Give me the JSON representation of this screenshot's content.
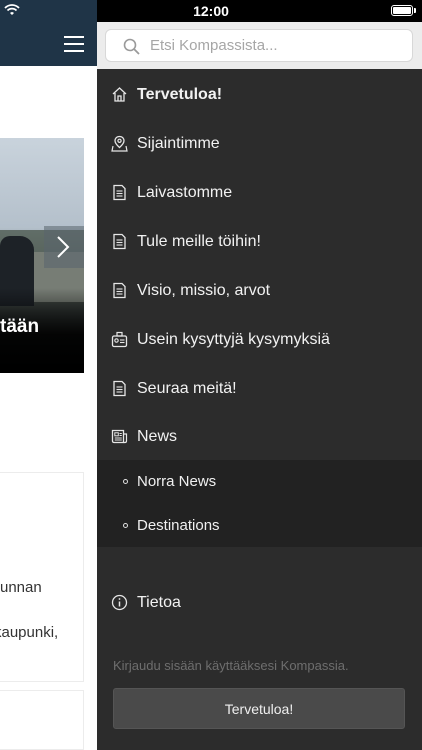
{
  "status_bar": {
    "time": "12:00"
  },
  "background_app": {
    "hero_title": "tään",
    "card": {
      "line1": "unnan",
      "line2": "kaupunki,"
    }
  },
  "drawer": {
    "search": {
      "placeholder": "Etsi Kompassista..."
    },
    "menu": [
      {
        "label": "Tervetuloa!",
        "icon": "home-icon"
      },
      {
        "label": "Sijaintimme",
        "icon": "map-pin-icon"
      },
      {
        "label": "Laivastomme",
        "icon": "document-icon"
      },
      {
        "label": "Tule meille töihin!",
        "icon": "document-icon"
      },
      {
        "label": "Visio, missio, arvot",
        "icon": "document-icon"
      },
      {
        "label": "Usein kysyttyjä kysymyksiä",
        "icon": "faq-icon"
      },
      {
        "label": "Seuraa meitä!",
        "icon": "document-icon"
      },
      {
        "label": "News",
        "icon": "newspaper-icon"
      }
    ],
    "submenu": [
      {
        "label": "Norra News"
      },
      {
        "label": "Destinations"
      }
    ],
    "about": {
      "label": "Tietoa",
      "icon": "info-icon"
    },
    "login_hint": "Kirjaudu sisään käyttääksesi Kompassia.",
    "login_button": "Tervetuloa!"
  }
}
